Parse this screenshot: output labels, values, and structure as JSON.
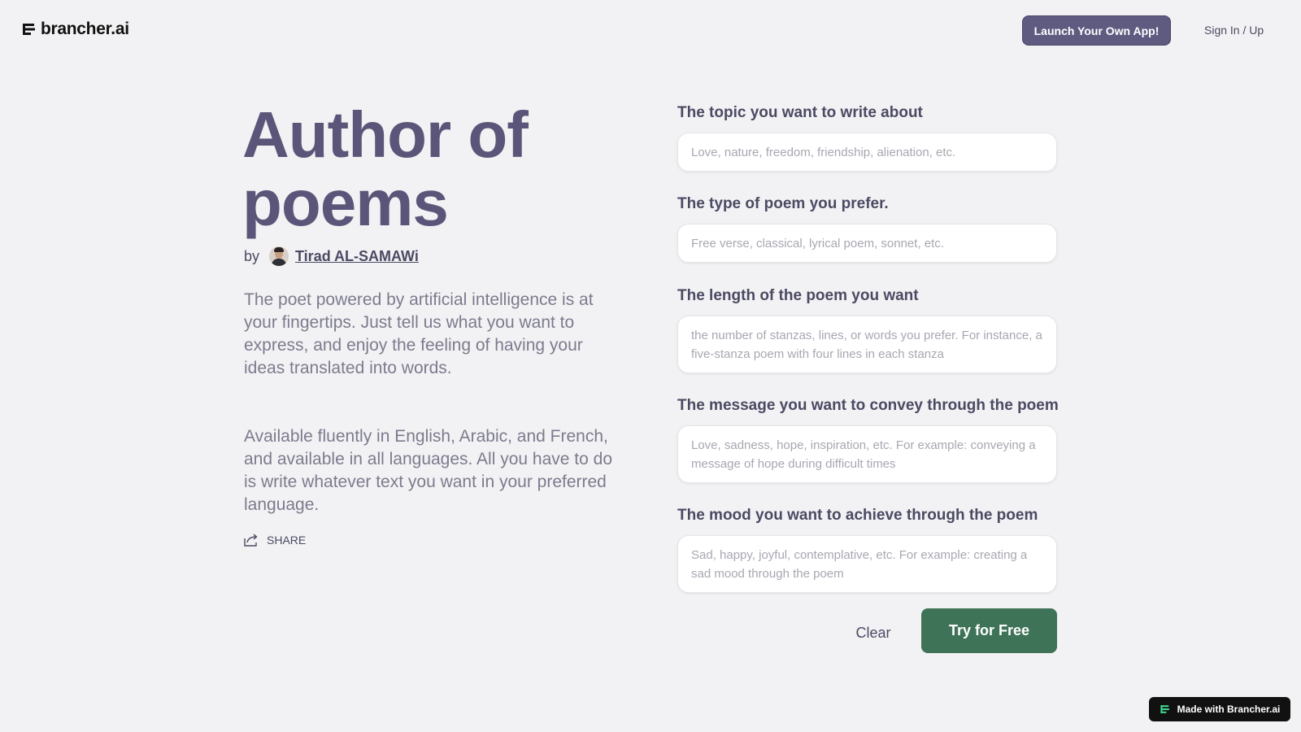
{
  "header": {
    "logo_text": "brancher.ai",
    "launch_label": "Launch Your Own App!",
    "signin_label": "Sign In / Up"
  },
  "app": {
    "title": "Author of poems",
    "by_label": "by",
    "author": "Tirad AL-SAMAWi",
    "description_1": "The poet powered by artificial intelligence is at your fingertips. Just tell us what you want to express, and enjoy the feeling of having your ideas translated into words.",
    "description_2": "Available fluently in English, Arabic, and French, and available in all languages. All you have to do is write whatever text you want in your preferred language.",
    "share_label": "SHARE"
  },
  "form": {
    "fields": [
      {
        "label": "The topic you want to write about",
        "value": "",
        "placeholder": "Love, nature, freedom, friendship, alienation, etc."
      },
      {
        "label": "The type of poem you prefer.",
        "value": "",
        "placeholder": "Free verse, classical, lyrical poem, sonnet, etc."
      },
      {
        "label": "The length of the poem you want",
        "value": "",
        "placeholder": "the number of stanzas, lines, or words you prefer. For instance, a five-stanza poem with four lines in each stanza"
      },
      {
        "label": "The message you want to convey through the poem",
        "value": "",
        "placeholder": "Love, sadness, hope, inspiration, etc. For example: conveying a message of hope during difficult times"
      },
      {
        "label": "The mood you want to achieve through the poem",
        "value": "",
        "placeholder": "Sad, happy, joyful, contemplative, etc. For example: creating a sad mood through the poem"
      }
    ],
    "clear_label": "Clear",
    "submit_label": "Try for Free"
  },
  "footer": {
    "badge_label": "Made with Brancher.ai"
  },
  "colors": {
    "background": "#f2f2f4",
    "accent": "#5f5a80",
    "submit": "#3e7358",
    "title": "#5b5679"
  },
  "icons": [
    "brancher-logo-icon",
    "share-icon",
    "brancher-badge-icon",
    "avatar"
  ]
}
